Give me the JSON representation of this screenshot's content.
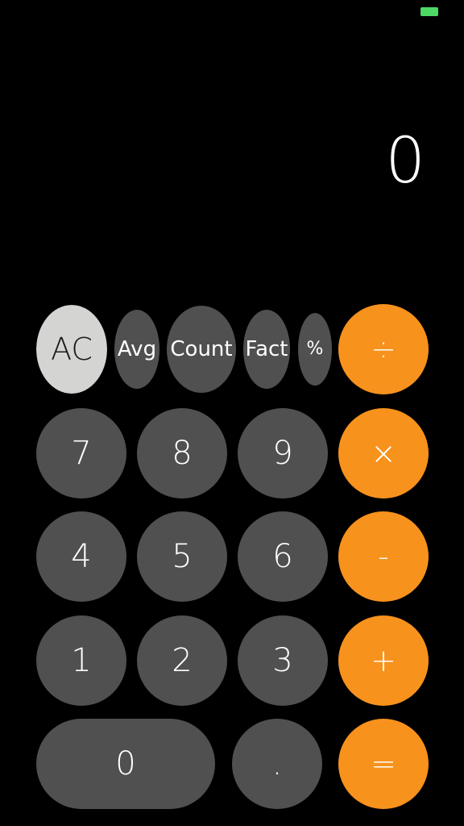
{
  "status_bar": {
    "battery_color": "#4cd964"
  },
  "display": {
    "value": "0"
  },
  "function_row": {
    "ac": "AC",
    "avg": "Avg",
    "count": "Count",
    "fact": "Fact",
    "percent": "%"
  },
  "digits": {
    "d0": "0",
    "d1": "1",
    "d2": "2",
    "d3": "3",
    "d4": "4",
    "d5": "5",
    "d6": "6",
    "d7": "7",
    "d8": "8",
    "d9": "9",
    "decimal": "."
  },
  "operators": {
    "divide": "÷",
    "multiply": "×",
    "subtract": "-",
    "add": "+",
    "equals": "="
  },
  "colors": {
    "background": "#000000",
    "number_key": "#505050",
    "operator_key": "#f7921d",
    "clear_key": "#d4d4d2"
  }
}
